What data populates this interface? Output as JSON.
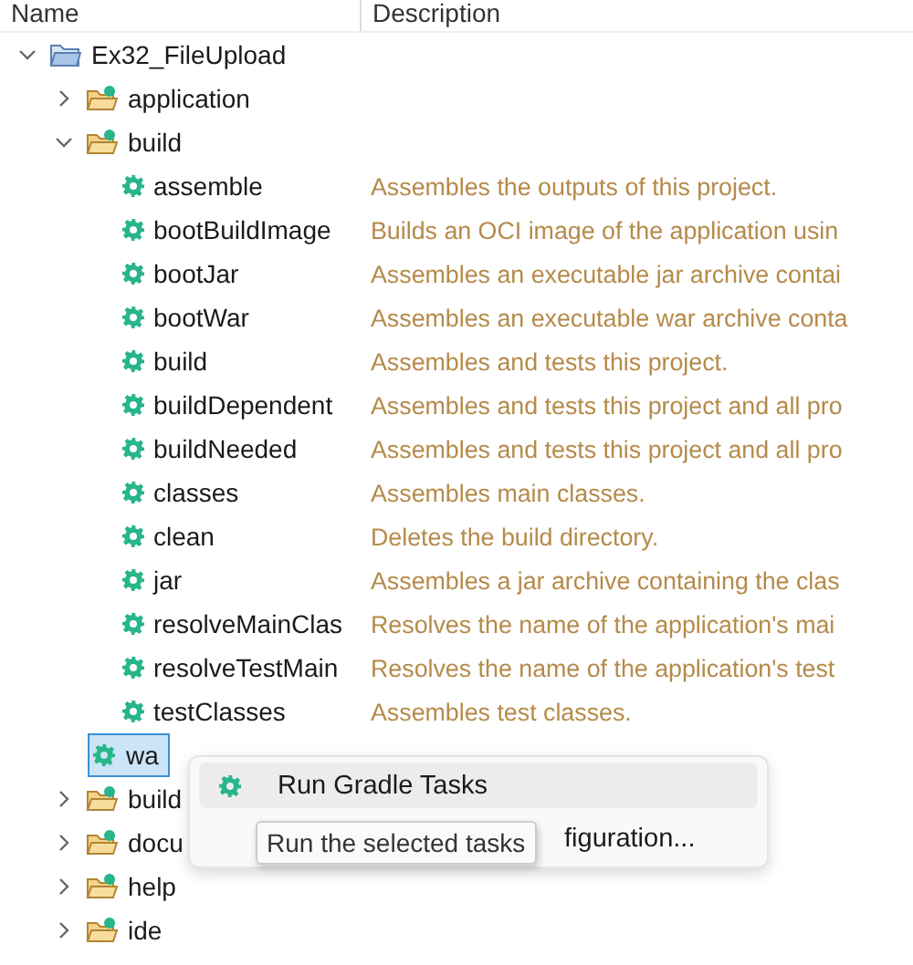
{
  "columns": [
    "Name",
    "Description"
  ],
  "tree": [
    {
      "name": "Ex32_FileUpload",
      "kind": "project",
      "expanded": true,
      "children": [
        {
          "name": "application",
          "kind": "folder",
          "expanded": false
        },
        {
          "name": "build",
          "kind": "folder",
          "expanded": true,
          "children": [
            {
              "name": "assemble",
              "kind": "task",
              "selected": false,
              "description": "Assembles the outputs of this project."
            },
            {
              "name": "bootBuildImage",
              "kind": "task",
              "selected": false,
              "description": "Builds an OCI image of the application usin"
            },
            {
              "name": "bootJar",
              "kind": "task",
              "selected": false,
              "description": "Assembles an executable jar archive contai"
            },
            {
              "name": "bootWar",
              "kind": "task",
              "selected": false,
              "description": "Assembles an executable war archive conta"
            },
            {
              "name": "build",
              "kind": "task",
              "selected": false,
              "description": "Assembles and tests this project."
            },
            {
              "name": "buildDependent",
              "kind": "task",
              "selected": false,
              "description": "Assembles and tests this project and all pro"
            },
            {
              "name": "buildNeeded",
              "kind": "task",
              "selected": false,
              "description": "Assembles and tests this project and all pro"
            },
            {
              "name": "classes",
              "kind": "task",
              "selected": false,
              "description": "Assembles main classes."
            },
            {
              "name": "clean",
              "kind": "task",
              "selected": false,
              "description": "Deletes the build directory."
            },
            {
              "name": "jar",
              "kind": "task",
              "selected": false,
              "description": "Assembles a jar archive containing the clas"
            },
            {
              "name": "resolveMainClas",
              "kind": "task",
              "selected": false,
              "description": "Resolves the name of the application's mai"
            },
            {
              "name": "resolveTestMain",
              "kind": "task",
              "selected": false,
              "description": "Resolves the name of the application's test"
            },
            {
              "name": "testClasses",
              "kind": "task",
              "selected": false,
              "description": "Assembles test classes."
            },
            {
              "name": "wa",
              "kind": "task",
              "selected": true
            }
          ]
        },
        {
          "name": "build",
          "kind": "folder",
          "expanded": false
        },
        {
          "name": "docu",
          "kind": "folder",
          "expanded": false
        },
        {
          "name": "help",
          "kind": "folder",
          "expanded": false
        },
        {
          "name": "ide",
          "kind": "folder",
          "expanded": false
        }
      ]
    }
  ],
  "context_menu": {
    "items": [
      {
        "label": "Run Gradle Tasks",
        "kind": "task",
        "selected": true
      },
      {
        "label": "figuration...",
        "kind": "plain",
        "selected": false
      }
    ],
    "tooltip": "Run the selected tasks"
  }
}
